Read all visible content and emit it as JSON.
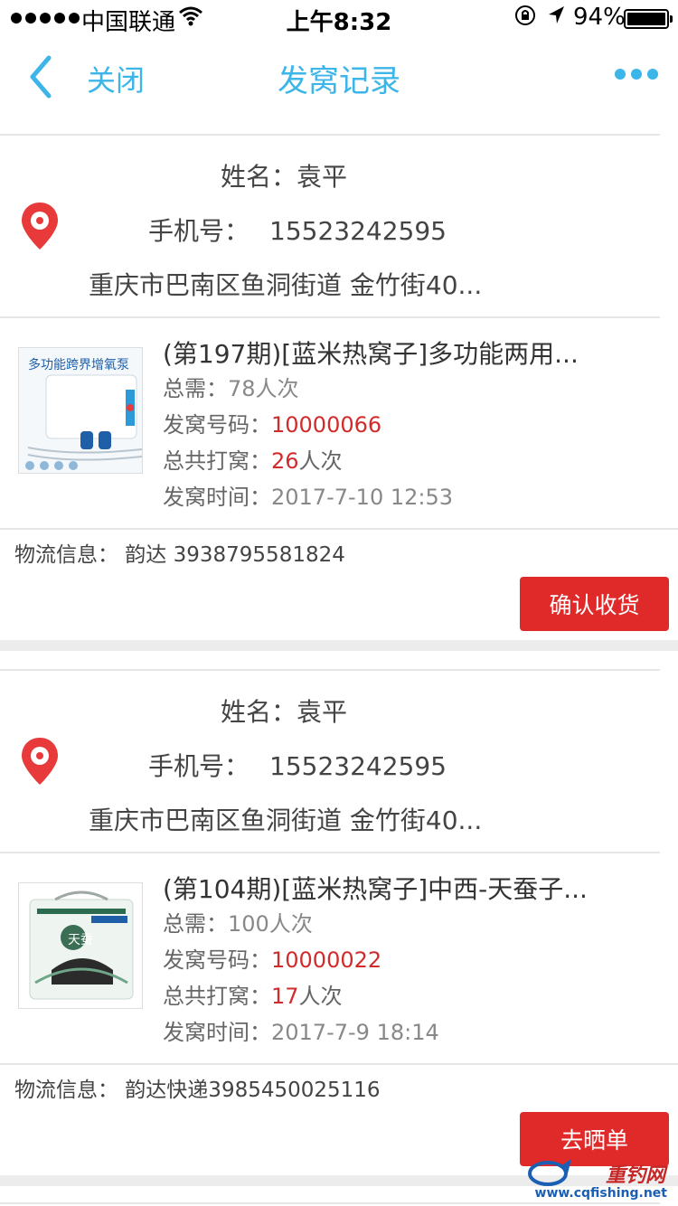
{
  "status_bar": {
    "carrier": "中国联通",
    "time": "上午8:32",
    "battery": "94%"
  },
  "nav": {
    "close_label": "关闭",
    "title": "发窝记录"
  },
  "orders": [
    {
      "name_label": "姓名：",
      "name": "袁平",
      "phone_label": "手机号：",
      "phone": "15523242595",
      "address": "重庆市巴南区鱼洞街道 金竹街40...",
      "product_title": "(第197期)[蓝米热窝子]多功能两用...",
      "total_label": "总需：",
      "total_value": "78人次",
      "code_label": "发窝号码：",
      "code_value": "10000066",
      "count_label": "总共打窝：",
      "count_value": "26",
      "count_unit": "人次",
      "time_label": "发窝时间：",
      "time_value": "2017-7-10 12:53",
      "logistics": "物流信息： 韵达 3938795581824",
      "action_label": "确认收货",
      "thumb_caption": "多功能跨界增氧泵"
    },
    {
      "name_label": "姓名：",
      "name": "袁平",
      "phone_label": "手机号：",
      "phone": "15523242595",
      "address": "重庆市巴南区鱼洞街道 金竹街40...",
      "product_title": "(第104期)[蓝米热窝子]中西-天蚕子...",
      "total_label": "总需：",
      "total_value": "100人次",
      "code_label": "发窝号码：",
      "code_value": "10000022",
      "count_label": "总共打窝：",
      "count_value": "17",
      "count_unit": "人次",
      "time_label": "发窝时间：",
      "time_value": "2017-7-9 18:14",
      "logistics": "物流信息： 韵达快递3985450025116",
      "action_label": "去晒单",
      "thumb_caption": "天蚕"
    }
  ],
  "watermark": {
    "text": "重钓网",
    "url": "www.cqfishing.net"
  },
  "colors": {
    "accent": "#3cb5e8",
    "button_red": "#e02a2a",
    "highlight_red": "#d22b2b"
  }
}
